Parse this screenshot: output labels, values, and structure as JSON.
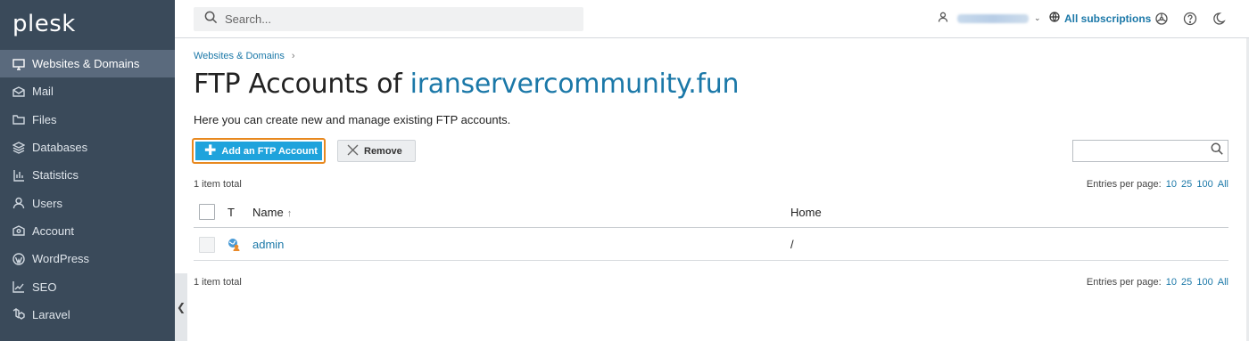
{
  "brand": {
    "logo_text": "plesk"
  },
  "sidebar": {
    "items": [
      {
        "label": "Websites & Domains",
        "icon": "monitor-icon",
        "active": true
      },
      {
        "label": "Mail",
        "icon": "mail-icon"
      },
      {
        "label": "Files",
        "icon": "folder-icon"
      },
      {
        "label": "Databases",
        "icon": "database-icon"
      },
      {
        "label": "Statistics",
        "icon": "bar-chart-icon"
      },
      {
        "label": "Users",
        "icon": "user-icon"
      },
      {
        "label": "Account",
        "icon": "account-icon"
      },
      {
        "label": "WordPress",
        "icon": "wordpress-icon"
      },
      {
        "label": "SEO",
        "icon": "seo-icon"
      },
      {
        "label": "Laravel",
        "icon": "laravel-icon"
      }
    ]
  },
  "topbar": {
    "search_placeholder": "Search...",
    "subscriptions_label": "All subscriptions",
    "icons": [
      "user-icon",
      "globe-icon",
      "extensions-icon",
      "help-icon",
      "dark-mode-icon"
    ]
  },
  "main": {
    "breadcrumb": "Websites & Domains",
    "title_prefix": "FTP Accounts of",
    "title_domain": "iranservercommunity.fun",
    "description": "Here you can create new and manage existing FTP accounts.",
    "add_button": "Add an FTP Account",
    "remove_button": "Remove",
    "items_total": "1 item total",
    "entries_per_page_label": "Entries per page:",
    "entries_options": [
      "10",
      "25",
      "100",
      "All"
    ]
  },
  "table": {
    "columns": {
      "type": "T",
      "name": "Name",
      "home": "Home"
    },
    "rows": [
      {
        "name": "admin",
        "home": "/"
      }
    ]
  },
  "colors": {
    "sidebar": "#3a4a5a",
    "accent": "#1b78a8",
    "add_button": "#1fa3dc",
    "highlight": "#e8891f"
  }
}
